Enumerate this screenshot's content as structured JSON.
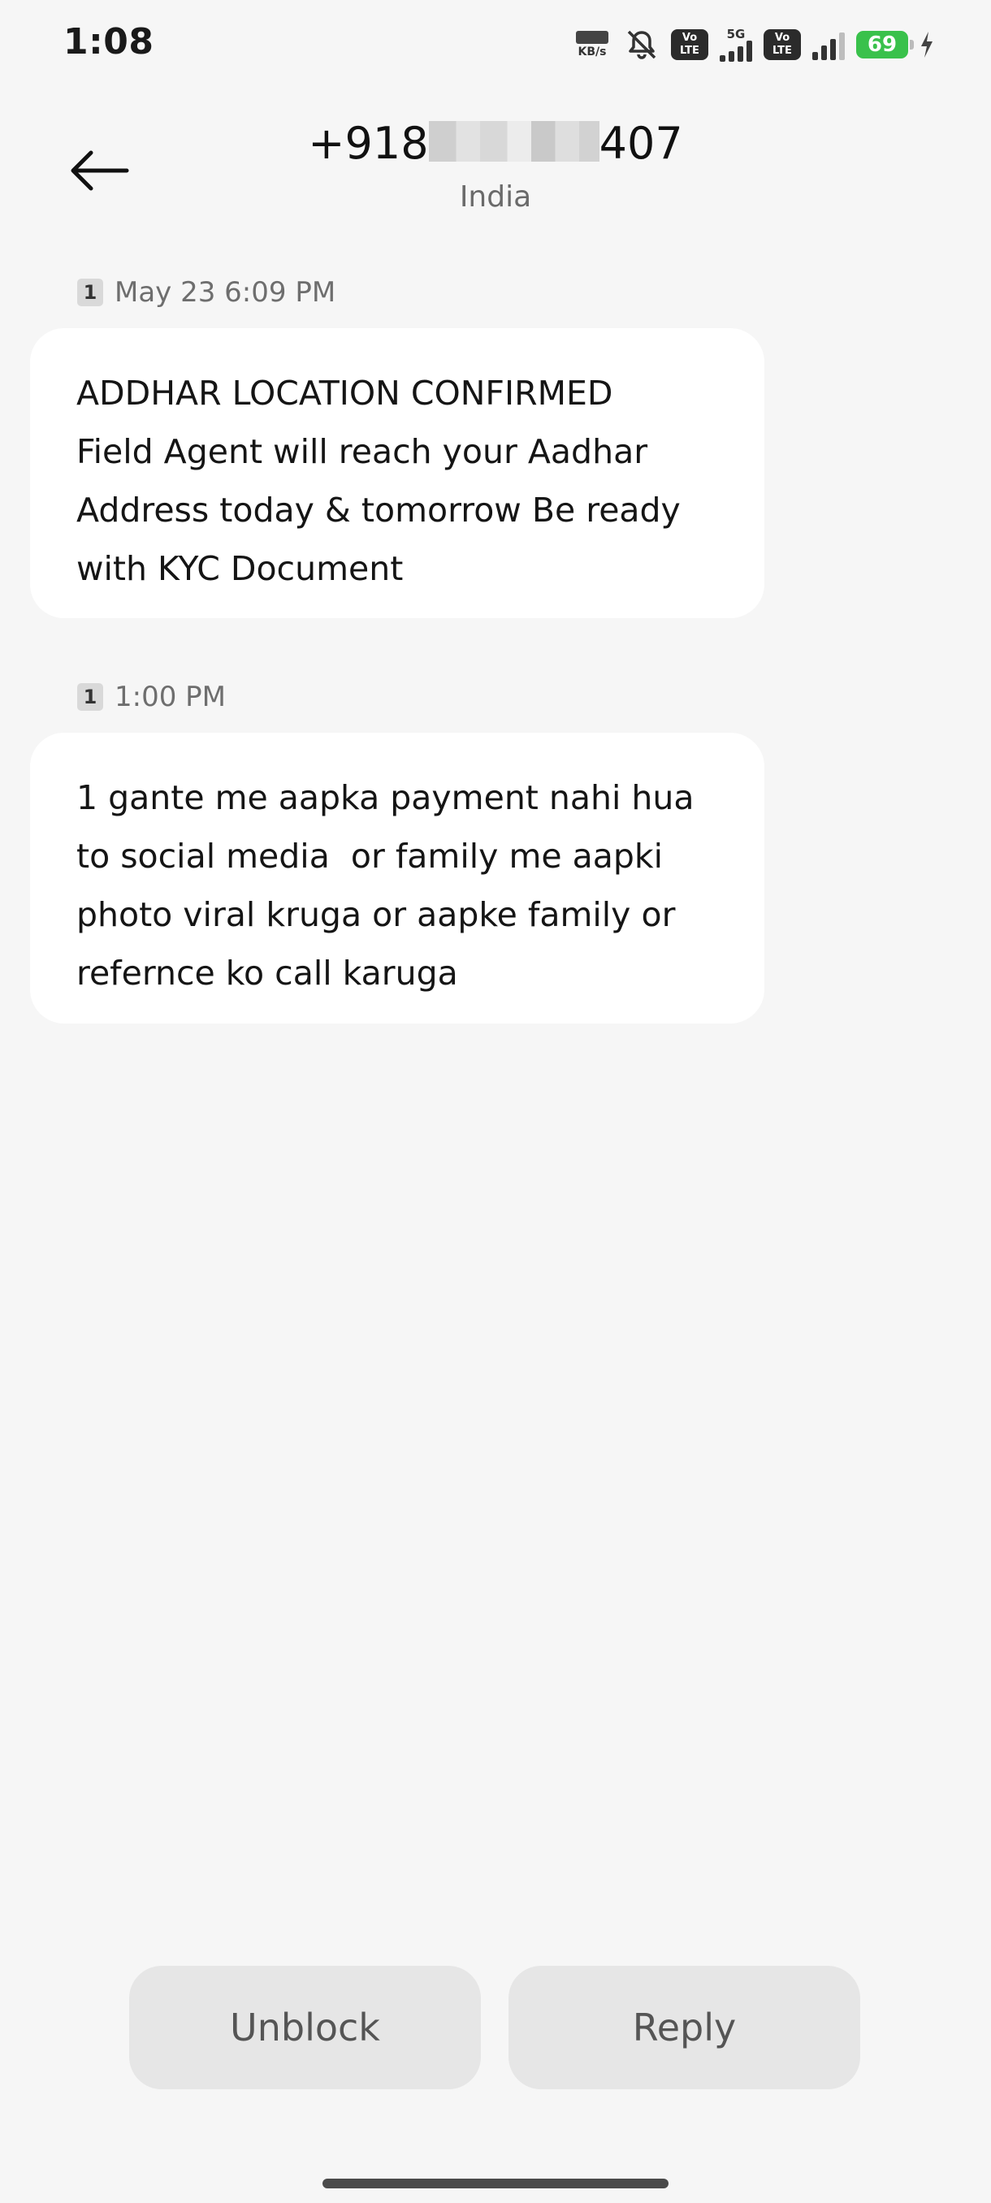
{
  "status_bar": {
    "time": "1:08",
    "speed_unit": "KB/s",
    "net_label": "5G",
    "volte_label": "Vo\nLTE",
    "battery": "69",
    "battery_color": "#39c14b"
  },
  "header": {
    "number_prefix": "+918",
    "number_suffix": "407",
    "country": "India"
  },
  "messages": [
    {
      "sim": "1",
      "timestamp": "May 23 6:09 PM",
      "text": "ADDHAR LOCATION CONFIRMED\nField Agent will reach your Aadhar\nAddress today & tomorrow Be ready\nwith KYC Document"
    },
    {
      "sim": "1",
      "timestamp": "1:00 PM",
      "text": "1 gante me aapka payment nahi hua\nto social media  or family me aapki\nphoto viral kruga or aapke family or\nrefernce ko call karuga"
    }
  ],
  "actions": {
    "unblock_label": "Unblock",
    "reply_label": "Reply"
  },
  "icons": {
    "back": "arrow-left-icon",
    "mute": "bell-off-icon",
    "charging": "bolt-icon"
  }
}
